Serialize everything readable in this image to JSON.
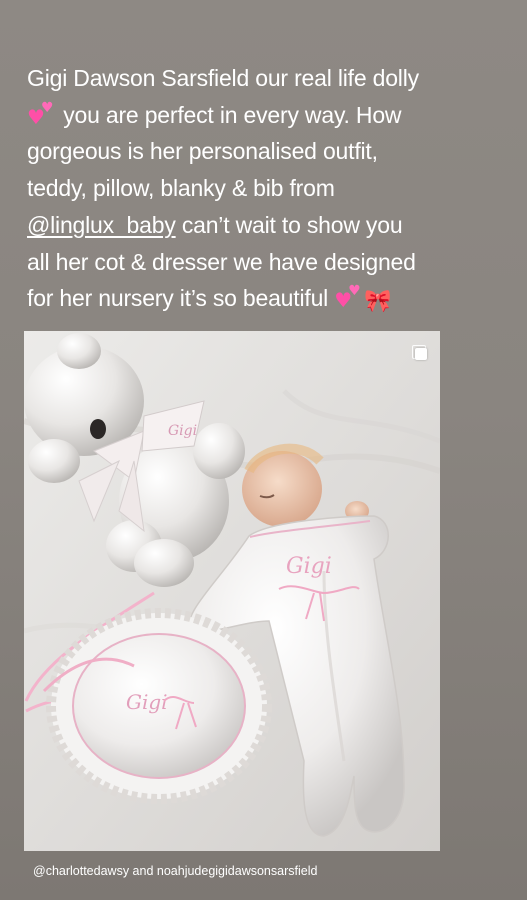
{
  "caption": {
    "line1": "Gigi Dawson Sarsfield our real life dolly",
    "line2": "you are perfect in every way. How",
    "line3": "gorgeous is her personalised outfit,",
    "line4": "teddy, pillow, blanky & bib from",
    "mention": "@linglux_baby",
    "line5_rest": " can’t wait to show you",
    "line6": "all her cot & dresser we have designed",
    "line7": "for her nursery it’s so beautiful"
  },
  "emojis": {
    "hearts_big": "♥",
    "hearts_small": "♥",
    "bow": "🎀"
  },
  "photo": {
    "outfit_text": "Gigi",
    "bib_text": "Gigi",
    "teddy_bib_text": "Gigi"
  },
  "tags": {
    "handle1": "@charlottedawsy",
    "joiner": " and ",
    "handle2": "noahjudegigidawsonsarsfield"
  },
  "colors": {
    "background": "#8a8580",
    "text": "#ffffff",
    "accent_pink": "#ff4fa7"
  },
  "icons": {
    "multi_post": "multiple-photos-icon"
  }
}
